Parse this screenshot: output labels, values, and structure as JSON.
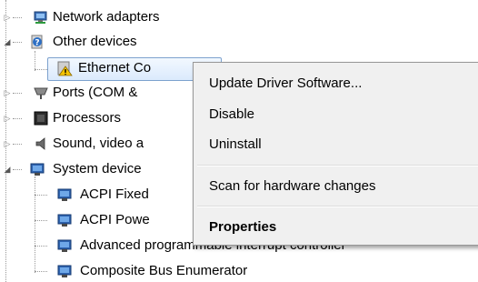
{
  "tree": {
    "items": [
      {
        "label": "Network adapters",
        "icon": "network-adapter-icon",
        "state": "collapsed"
      },
      {
        "label": "Other devices",
        "icon": "unknown-device-icon",
        "state": "expanded"
      },
      {
        "label": "Ethernet Co",
        "icon": "warning-device-icon",
        "state": "leaf",
        "selected": true
      },
      {
        "label": "Ports (COM &",
        "icon": "port-icon",
        "state": "collapsed"
      },
      {
        "label": "Processors",
        "icon": "processor-icon",
        "state": "collapsed"
      },
      {
        "label": "Sound, video a",
        "icon": "speaker-icon",
        "state": "collapsed"
      },
      {
        "label": "System device",
        "icon": "system-device-icon",
        "state": "expanded"
      },
      {
        "label": "ACPI Fixed",
        "icon": "system-device-icon",
        "state": "leaf"
      },
      {
        "label": "ACPI Powe",
        "icon": "system-device-icon",
        "state": "leaf"
      },
      {
        "label": "Advanced programmable interrupt controller",
        "icon": "system-device-icon",
        "state": "leaf"
      },
      {
        "label": "Composite Bus Enumerator",
        "icon": "system-device-icon",
        "state": "leaf"
      }
    ]
  },
  "context_menu": {
    "items": [
      {
        "label": "Update Driver Software...",
        "bold": false
      },
      {
        "label": "Disable",
        "bold": false
      },
      {
        "label": "Uninstall",
        "bold": false
      },
      {
        "label": "Scan for hardware changes",
        "bold": false
      },
      {
        "label": "Properties",
        "bold": true
      }
    ]
  },
  "colors": {
    "selection_border": "#7da2ce",
    "menu_background": "#f0f0f0",
    "warning": "#f5c400"
  }
}
